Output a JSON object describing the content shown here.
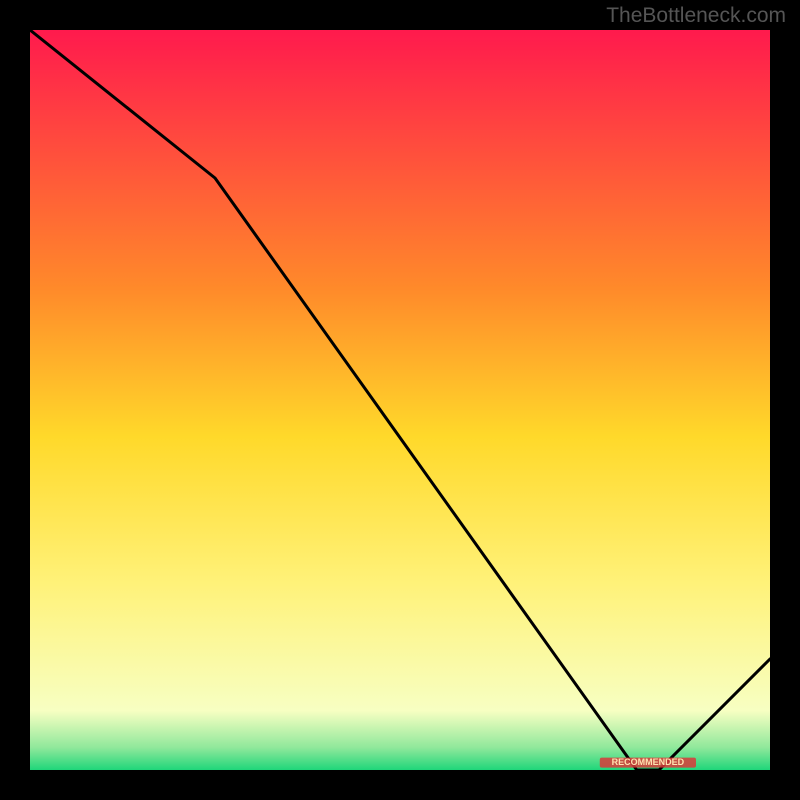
{
  "watermark": "TheBottleneck.com",
  "chart_data": {
    "type": "line",
    "title": "",
    "xlabel": "",
    "ylabel": "",
    "xlim": [
      0,
      100
    ],
    "ylim": [
      0,
      100
    ],
    "line": {
      "name": "bottleneck-curve",
      "x": [
        0,
        25,
        82,
        85,
        100
      ],
      "y": [
        100,
        80,
        0,
        0,
        15
      ]
    },
    "background_gradient": {
      "stops": [
        {
          "pos": 0,
          "color": "#ff1a4d"
        },
        {
          "pos": 35,
          "color": "#ff8a2a"
        },
        {
          "pos": 55,
          "color": "#ffd92a"
        },
        {
          "pos": 75,
          "color": "#fff27a"
        },
        {
          "pos": 92,
          "color": "#f7ffc2"
        },
        {
          "pos": 97,
          "color": "#8fe89b"
        },
        {
          "pos": 100,
          "color": "#1fd67a"
        }
      ]
    },
    "band_label": {
      "text": "RECOMMENDED",
      "x_start": 77,
      "x_end": 90,
      "y": 1
    }
  }
}
